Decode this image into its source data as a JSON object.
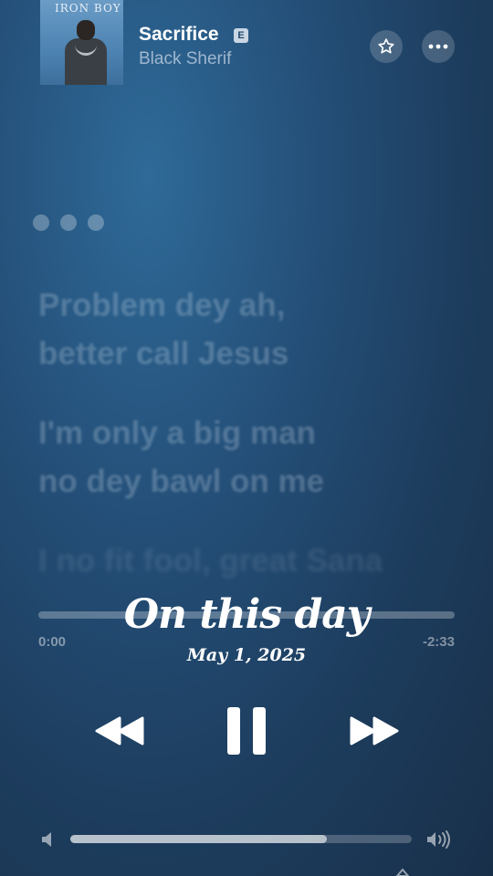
{
  "now_playing": {
    "album_art_text": "IRON BOY",
    "title": "Sacrifice",
    "explicit_badge": "E",
    "artist": "Black Sherif"
  },
  "icons": {
    "favorite": "star-icon",
    "more": "more-icon",
    "rewind": "rewind-icon",
    "pause": "pause-icon",
    "forward": "forward-icon",
    "volume_low": "speaker-low-icon",
    "volume_high": "speaker-high-icon",
    "airplay": "airplay-icon"
  },
  "lyrics": [
    "Problem dey ah,",
    "better call Jesus",
    "I'm only a big man",
    "no dey bawl on me",
    "I no fit fool, great Sana"
  ],
  "progress": {
    "elapsed": "0:00",
    "remaining": "-2:33",
    "fraction": 0.0
  },
  "overlay": {
    "title": "On this day",
    "date": "May 1, 2025"
  },
  "volume": {
    "level": 0.75
  },
  "colors": {
    "background_top": "#2f6a98",
    "background_bottom": "#182f49",
    "secondary_text": "#9fb7cf"
  }
}
